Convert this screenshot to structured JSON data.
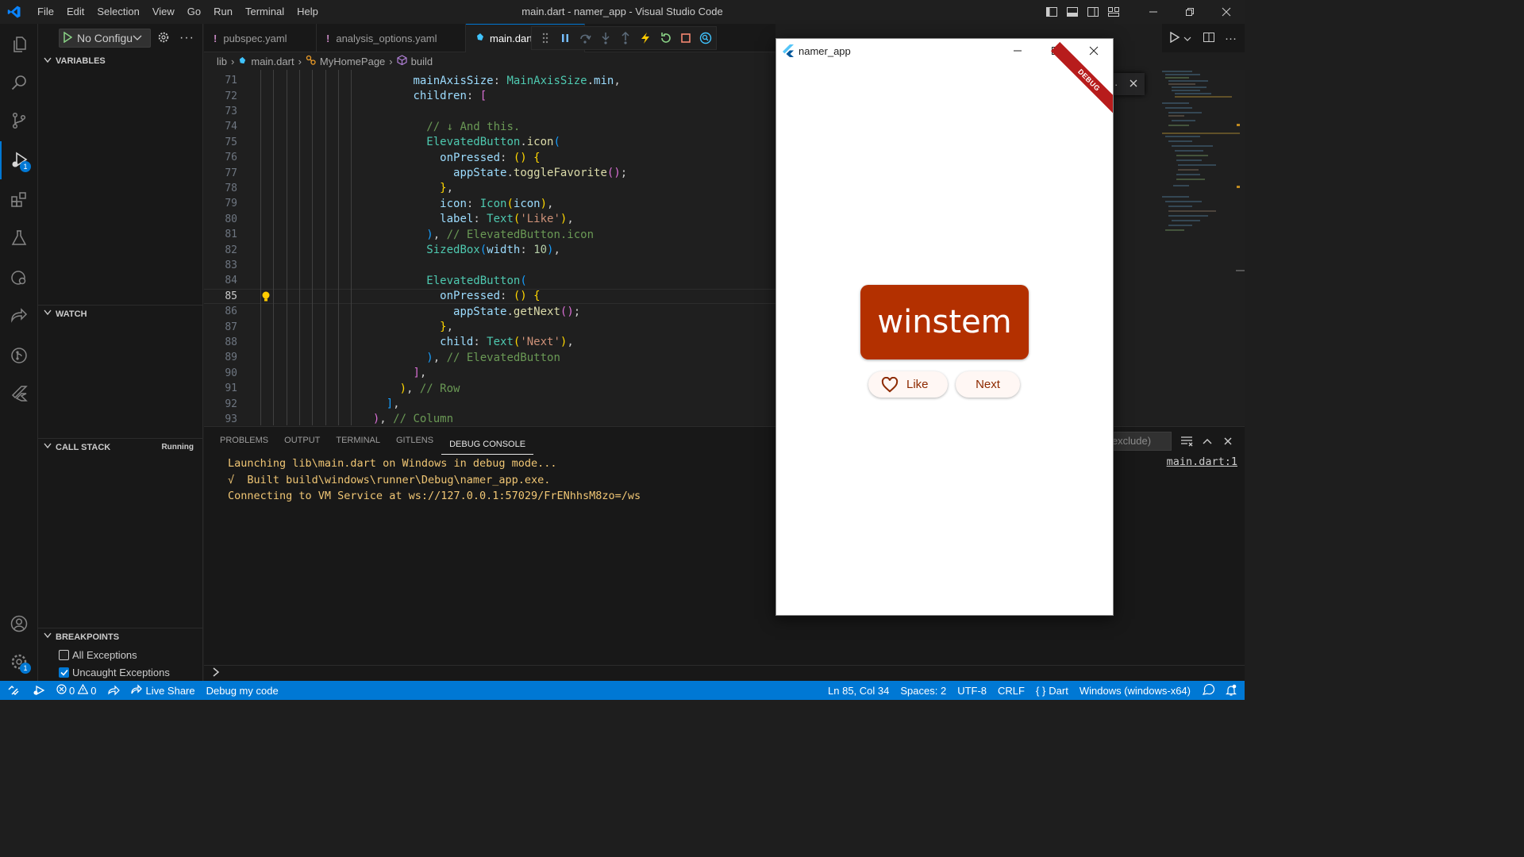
{
  "window_title": "main.dart - namer_app - Visual Studio Code",
  "menu": [
    "File",
    "Edit",
    "Selection",
    "View",
    "Go",
    "Run",
    "Terminal",
    "Help"
  ],
  "sidebar": {
    "config_label": "No Configurations",
    "variables_title": "VARIABLES",
    "watch_title": "WATCH",
    "callstack_title": "CALL STACK",
    "callstack_status": "Running",
    "breakpoints_title": "BREAKPOINTS",
    "breakpoints": [
      {
        "label": "All Exceptions",
        "checked": false
      },
      {
        "label": "Uncaught Exceptions",
        "checked": true
      }
    ]
  },
  "activity_badges": {
    "debug": "1",
    "settings": "1"
  },
  "tabs": [
    {
      "label": "pubspec.yaml",
      "marker": "!"
    },
    {
      "label": "analysis_options.yaml",
      "marker": "!"
    },
    {
      "label": "main.dart",
      "marker": ""
    }
  ],
  "breadcrumb": [
    "lib",
    "main.dart",
    "MyHomePage",
    "build"
  ],
  "code": {
    "current_line": 85,
    "lines": [
      {
        "n": 71,
        "indent": 10,
        "tokens": [
          [
            "p",
            "mainAxisSize"
          ],
          [
            "t",
            ": "
          ],
          [
            "c",
            "MainAxisSize"
          ],
          [
            "t",
            "."
          ],
          [
            "p",
            "min"
          ],
          [
            "t",
            ","
          ]
        ]
      },
      {
        "n": 72,
        "indent": 10,
        "tokens": [
          [
            "p",
            "children"
          ],
          [
            "t",
            ": "
          ],
          [
            "b2",
            "["
          ]
        ]
      },
      {
        "n": 73,
        "indent": 0,
        "tokens": []
      },
      {
        "n": 74,
        "indent": 12,
        "tokens": [
          [
            "m",
            "// ↓ And this."
          ]
        ]
      },
      {
        "n": 75,
        "indent": 12,
        "tokens": [
          [
            "c",
            "ElevatedButton"
          ],
          [
            "t",
            "."
          ],
          [
            "f",
            "icon"
          ],
          [
            "b3",
            "("
          ]
        ]
      },
      {
        "n": 76,
        "indent": 14,
        "tokens": [
          [
            "p",
            "onPressed"
          ],
          [
            "t",
            ": "
          ],
          [
            "b1",
            "()"
          ],
          [
            "t",
            " "
          ],
          [
            "b1",
            "{"
          ]
        ]
      },
      {
        "n": 77,
        "indent": 16,
        "tokens": [
          [
            "p",
            "appState"
          ],
          [
            "t",
            "."
          ],
          [
            "f",
            "toggleFavorite"
          ],
          [
            "b2",
            "()"
          ],
          [
            "t",
            ";"
          ]
        ]
      },
      {
        "n": 78,
        "indent": 14,
        "tokens": [
          [
            "b1",
            "}"
          ],
          [
            "t",
            ","
          ]
        ]
      },
      {
        "n": 79,
        "indent": 14,
        "tokens": [
          [
            "p",
            "icon"
          ],
          [
            "t",
            ": "
          ],
          [
            "c",
            "Icon"
          ],
          [
            "b1",
            "("
          ],
          [
            "p",
            "icon"
          ],
          [
            "b1",
            ")"
          ],
          [
            "t",
            ","
          ]
        ]
      },
      {
        "n": 80,
        "indent": 14,
        "tokens": [
          [
            "p",
            "label"
          ],
          [
            "t",
            ": "
          ],
          [
            "c",
            "Text"
          ],
          [
            "b1",
            "("
          ],
          [
            "s",
            "'Like'"
          ],
          [
            "b1",
            ")"
          ],
          [
            "t",
            ","
          ]
        ]
      },
      {
        "n": 81,
        "indent": 12,
        "tokens": [
          [
            "b3",
            ")"
          ],
          [
            "t",
            ", "
          ],
          [
            "m",
            "// ElevatedButton.icon"
          ]
        ]
      },
      {
        "n": 82,
        "indent": 12,
        "tokens": [
          [
            "c",
            "SizedBox"
          ],
          [
            "b3",
            "("
          ],
          [
            "p",
            "width"
          ],
          [
            "t",
            ": "
          ],
          [
            "n",
            "10"
          ],
          [
            "b3",
            ")"
          ],
          [
            "t",
            ","
          ]
        ]
      },
      {
        "n": 83,
        "indent": 0,
        "tokens": []
      },
      {
        "n": 84,
        "indent": 12,
        "tokens": [
          [
            "c",
            "ElevatedButton"
          ],
          [
            "b3",
            "("
          ]
        ]
      },
      {
        "n": 85,
        "indent": 14,
        "tokens": [
          [
            "p",
            "onPressed"
          ],
          [
            "t",
            ": "
          ],
          [
            "b1",
            "()"
          ],
          [
            "t",
            " "
          ],
          [
            "b1",
            "{"
          ]
        ]
      },
      {
        "n": 86,
        "indent": 16,
        "tokens": [
          [
            "p",
            "appState"
          ],
          [
            "t",
            "."
          ],
          [
            "f",
            "getNext"
          ],
          [
            "b2",
            "()"
          ],
          [
            "t",
            ";"
          ]
        ]
      },
      {
        "n": 87,
        "indent": 14,
        "tokens": [
          [
            "b1",
            "}"
          ],
          [
            "t",
            ","
          ]
        ]
      },
      {
        "n": 88,
        "indent": 14,
        "tokens": [
          [
            "p",
            "child"
          ],
          [
            "t",
            ": "
          ],
          [
            "c",
            "Text"
          ],
          [
            "b1",
            "("
          ],
          [
            "s",
            "'Next'"
          ],
          [
            "b1",
            ")"
          ],
          [
            "t",
            ","
          ]
        ]
      },
      {
        "n": 89,
        "indent": 12,
        "tokens": [
          [
            "b3",
            ")"
          ],
          [
            "t",
            ", "
          ],
          [
            "m",
            "// ElevatedButton"
          ]
        ]
      },
      {
        "n": 90,
        "indent": 10,
        "tokens": [
          [
            "b2",
            "]"
          ],
          [
            "t",
            ","
          ]
        ]
      },
      {
        "n": 91,
        "indent": 8,
        "tokens": [
          [
            "b1",
            ")"
          ],
          [
            "t",
            ", "
          ],
          [
            "m",
            "// Row"
          ]
        ]
      },
      {
        "n": 92,
        "indent": 6,
        "tokens": [
          [
            "b3",
            "]"
          ],
          [
            "t",
            ","
          ]
        ]
      },
      {
        "n": 93,
        "indent": 4,
        "tokens": [
          [
            "b2",
            ")"
          ],
          [
            "t",
            ", "
          ],
          [
            "m",
            "// Column"
          ]
        ]
      }
    ]
  },
  "panel": {
    "tabs": [
      "PROBLEMS",
      "OUTPUT",
      "TERMINAL",
      "GITLENS",
      "DEBUG CONSOLE"
    ],
    "active_tab": "DEBUG CONSOLE",
    "filter_placeholder": "Filter (e.g. text, !exclude)",
    "console_lines": [
      "Launching lib\\main.dart on Windows in debug mode...",
      "√  Built build\\windows\\runner\\Debug\\namer_app.exe.",
      "Connecting to VM Service at ws://127.0.0.1:57029/FrENhhsM8zo=/ws"
    ],
    "source_link": "main.dart:1"
  },
  "statusbar": {
    "problems_errors": "0",
    "problems_warnings": "0",
    "live_share": "Live Share",
    "debug_my_code": "Debug my code",
    "position": "Ln 85, Col 34",
    "spaces": "Spaces: 2",
    "encoding": "UTF-8",
    "eol": "CRLF",
    "language": "Dart",
    "device": "Windows (windows-x64)"
  },
  "app": {
    "title": "namer_app",
    "debug_banner": "DEBUG",
    "word": "winstem",
    "like_label": "Like",
    "next_label": "Next",
    "card_color": "#b33000"
  },
  "colors": {
    "accent": "#0078d4",
    "statusbar": "#0078d4"
  }
}
